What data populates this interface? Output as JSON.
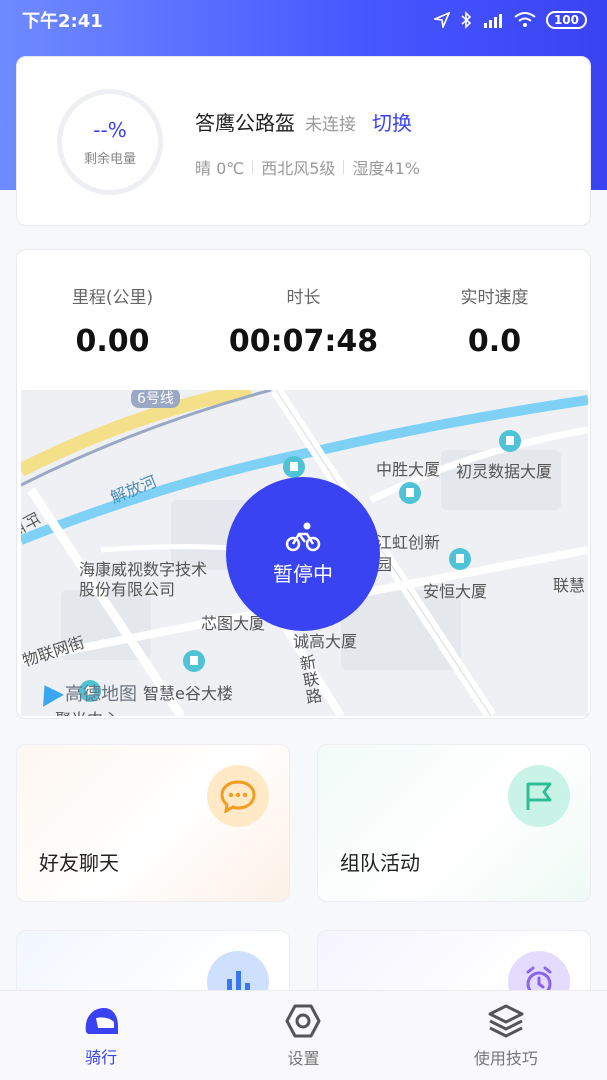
{
  "status_bar": {
    "time": "下午2:41",
    "battery": "100"
  },
  "device": {
    "battery_percent": "--%",
    "battery_label": "剩余电量",
    "name": "答鹰公路盔",
    "state": "未连接",
    "switch_label": "切换",
    "weather": [
      "晴 0℃",
      "西北风5级",
      "湿度41%"
    ]
  },
  "ride": {
    "stats": [
      {
        "label": "里程(公里)",
        "value": "0.00"
      },
      {
        "label": "时长",
        "value": "00:07:48"
      },
      {
        "label": "实时速度",
        "value": "0.0"
      }
    ],
    "pause_label": "暂停中"
  },
  "map": {
    "labels": {
      "line6": "6号线",
      "river": "解放河",
      "road_qianmo": "阡陌路",
      "zhongsheng": "中胜大厦",
      "chuling": "初灵数据大厦",
      "hikvision": "海康威视数字技术股份有限公司",
      "jianghong": "江虹创新园",
      "anheng": "安恒大厦",
      "lianhui": "联慧",
      "xintu": "芯图大厦",
      "chenggao": "诚高大厦",
      "xinlian": "新联路",
      "lianwang": "物联网街",
      "zhihui": "智慧e谷大楼",
      "juguang": "聚光中心",
      "logo": "高德地图"
    }
  },
  "tiles": [
    {
      "title": "好友聊天",
      "icon": "chat-bubble-icon"
    },
    {
      "title": "组队活动",
      "icon": "flag-icon"
    },
    {
      "title": "",
      "icon": "bar-chart-icon"
    },
    {
      "title": "",
      "icon": "alarm-clock-icon"
    }
  ],
  "tabs": [
    {
      "label": "骑行",
      "icon": "helmet-icon",
      "active": true
    },
    {
      "label": "设置",
      "icon": "settings-hexagon-icon",
      "active": false
    },
    {
      "label": "使用技巧",
      "icon": "layers-icon",
      "active": false
    }
  ],
  "colors": {
    "brand": "#3a43f2",
    "map_water": "#7fd0f5",
    "map_poi": "#4fc3d5"
  }
}
